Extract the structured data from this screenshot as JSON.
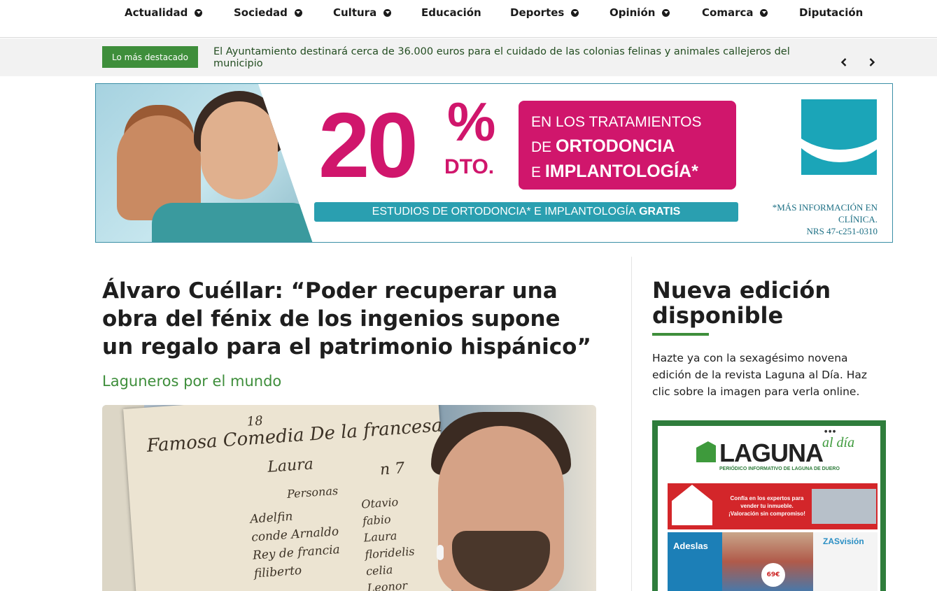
{
  "nav": {
    "items": [
      {
        "label": "Actualidad",
        "has_dropdown": true
      },
      {
        "label": "Sociedad",
        "has_dropdown": true
      },
      {
        "label": "Cultura",
        "has_dropdown": true
      },
      {
        "label": "Educación",
        "has_dropdown": false
      },
      {
        "label": "Deportes",
        "has_dropdown": true
      },
      {
        "label": "Opinión",
        "has_dropdown": true
      },
      {
        "label": "Comarca",
        "has_dropdown": true
      },
      {
        "label": "Diputación",
        "has_dropdown": false
      }
    ]
  },
  "ticker": {
    "label": "Lo más destacado",
    "headline": "El Ayuntamiento destinará cerca de 36.000 euros para el cuidado de las colonias felinas y animales callejeros del municipio",
    "prev_icon": "chevron-left-icon",
    "next_icon": "chevron-right-icon"
  },
  "banner": {
    "discount_number": "20",
    "discount_percent": "%",
    "discount_suffix": "DTO.",
    "box_line1": "EN LOS TRATAMIENTOS",
    "box_line2_prefix": "DE",
    "box_line2_bold": "ORTODONCIA",
    "box_line3_prefix": "E",
    "box_line3_bold": "IMPLANTOLOGÍA*",
    "bar_text_prefix": "ESTUDIOS DE ORTODONCIA* E IMPLANTOLOGÍA",
    "bar_text_bold": "GRATIS",
    "fine_print_1": "*MÁS INFORMACIÓN EN CLÍNICA.",
    "fine_print_2": "NRS 47-c251-0310",
    "colors": {
      "magenta": "#d0166c",
      "teal": "#2a9fb0"
    }
  },
  "article": {
    "title": "Álvaro Cuéllar: “Poder recuperar una obra del fénix de los ingenios supone un regalo para el patrimonio hispánico”",
    "category": "Laguneros por el mundo",
    "image": {
      "ms_number": "18",
      "ms_title": "Famosa Comedia De la francesa",
      "ms_subtitle": "Laura",
      "ms_mark": "n 7",
      "ms_heading": "Personas",
      "ms_names_left": [
        "Adelfin",
        "conde Arnaldo",
        "Rey de francia",
        "filiberto"
      ],
      "ms_names_right": [
        "Otavio",
        "fabio",
        "Laura",
        "floridelis",
        "celia",
        "Leonor"
      ]
    }
  },
  "sidebar": {
    "title": "Nueva edición disponible",
    "text": "Hazte ya con la sexagésimo novena edición de la revista Laguna al Día. Haz clic sobre la imagen para verla online.",
    "magazine": {
      "logo": "LAGUNA",
      "logo_suffix": "al día",
      "subtitle": "PERIÓDICO INFORMATIVO DE LAGUNA DE DUERO",
      "ad_text": "Confía en los expertos para vender tu inmueble. ¡Valoración sin compromiso!",
      "brand_1": "Adeslas",
      "brand_2": "ZASvisión",
      "price": "69€"
    }
  },
  "colors": {
    "accent_green": "#3e8e3b",
    "text_dark": "#1e1e1e"
  }
}
